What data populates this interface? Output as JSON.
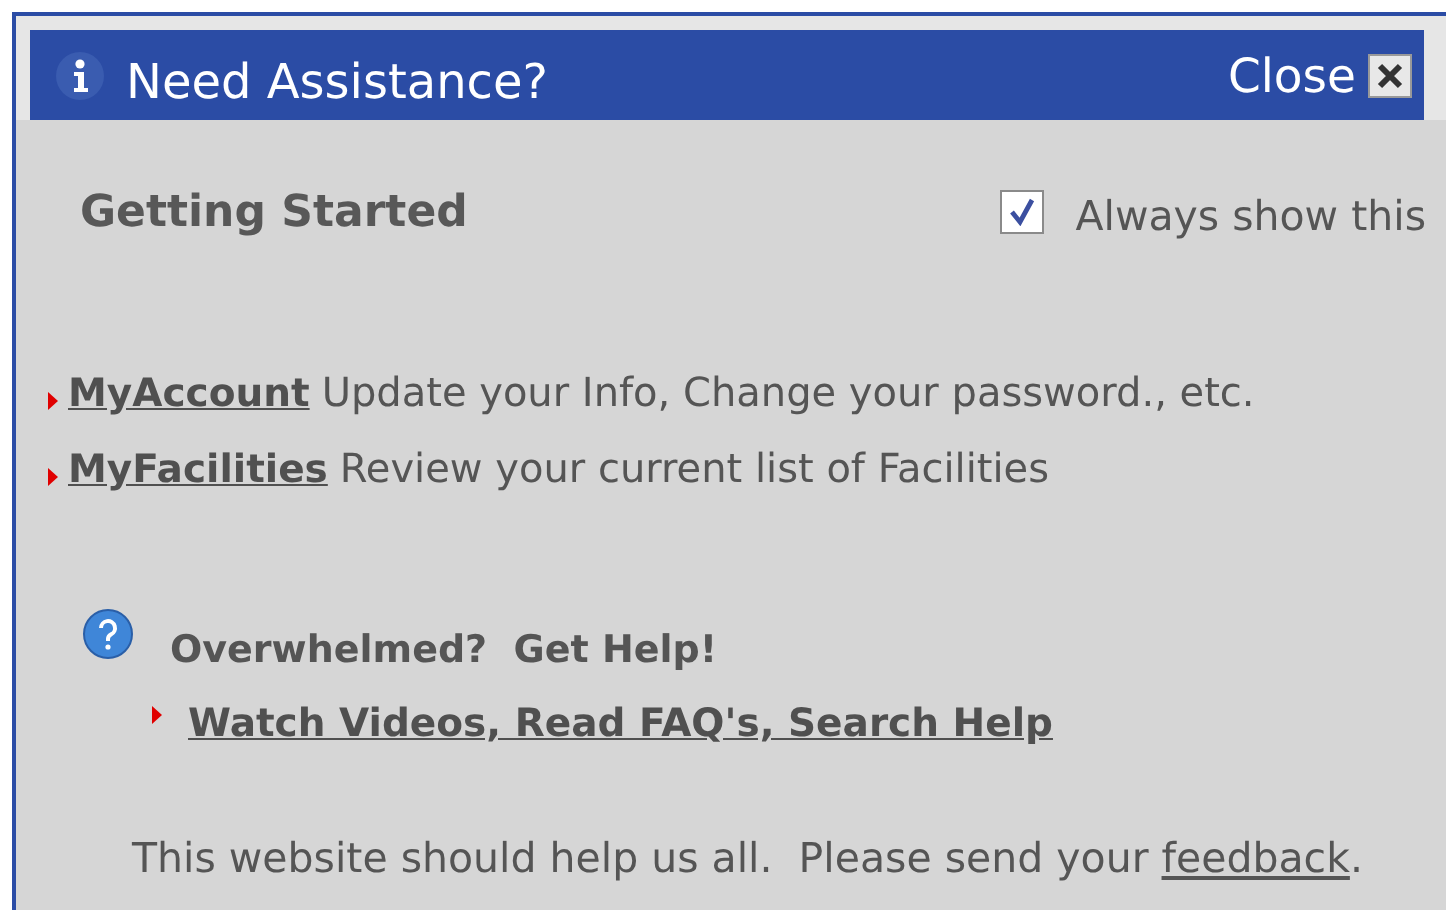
{
  "window": {
    "title": "Need Assistance?",
    "close": "Close"
  },
  "heading": "Getting Started",
  "always_show": {
    "label": "Always show this",
    "checked": true
  },
  "links": [
    {
      "link": "MyAccount",
      "description": "Update your Info, Change your password., etc."
    },
    {
      "link": "MyFacilities",
      "description": "Review your current list of Facilities"
    }
  ],
  "help": {
    "heading": "Overwhelmed?  Get Help!",
    "link": "Watch Videos, Read FAQ's, Search Help"
  },
  "footer": {
    "before": "This website should help us all.  Please send your ",
    "link": "feedback",
    "after": "."
  }
}
